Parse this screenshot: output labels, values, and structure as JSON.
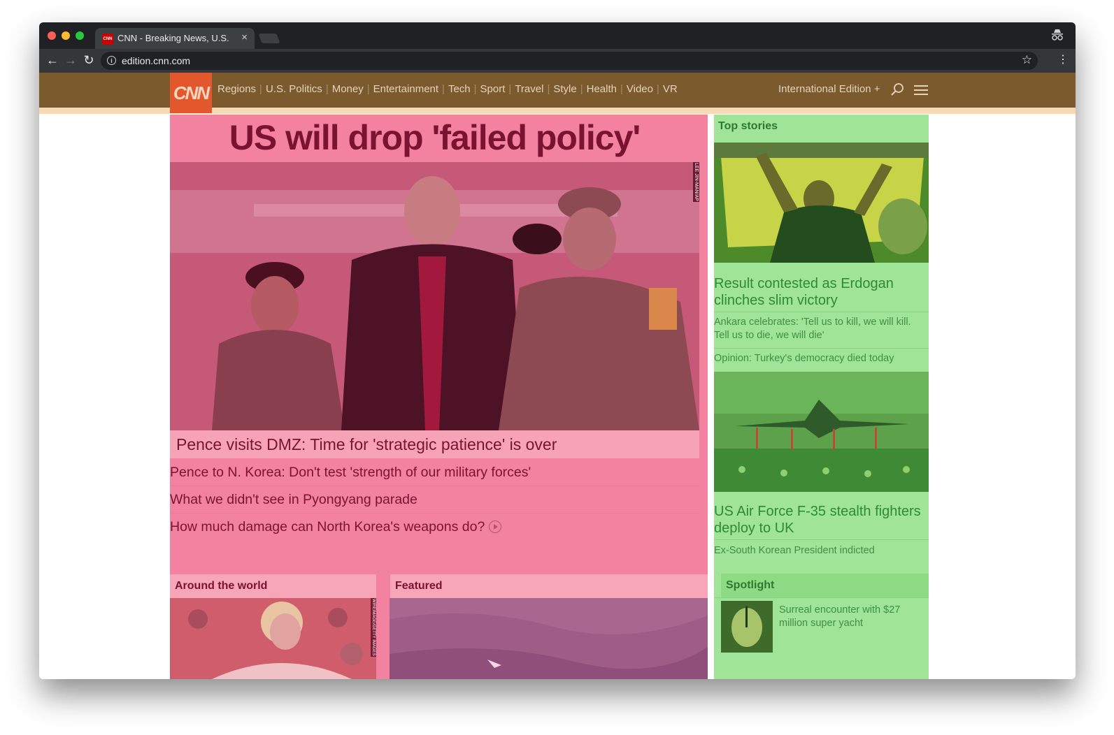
{
  "browser": {
    "tab_title": "CNN - Breaking News, U.S., W",
    "favicon_text": "CNN",
    "url": "edition.cnn.com"
  },
  "nav": {
    "logo": "CNN",
    "links": [
      "Regions",
      "U.S. Politics",
      "Money",
      "Entertainment",
      "Tech",
      "Sport",
      "Travel",
      "Style",
      "Health",
      "Video",
      "VR"
    ],
    "edition": "International Edition +"
  },
  "main": {
    "headline": "US will drop 'failed policy'",
    "hero_credit": "LEE JIN-MAN/AP",
    "hero_caption": "Pence visits DMZ: Time for 'strategic patience' is over",
    "related": [
      "Pence to N. Korea: Don't test 'strength of our military forces'",
      "What we didn't see in Pyongyang parade",
      "How much damage can North Korea's weapons do?"
    ],
    "around_world": "Around the world",
    "around_credit": "WIREIMAGE/GETTY IMAGES",
    "featured": "Featured"
  },
  "side": {
    "heading": "Top stories",
    "story1_title": "Result contested as Erdogan clinches slim victory",
    "story1_items": [
      "Ankara celebrates: 'Tell us to kill, we will kill. Tell us to die, we will die'",
      "Opinion: Turkey's democracy died today"
    ],
    "story2_title": "US Air Force F-35 stealth fighters deploy to UK",
    "story2_items": [
      "Ex-South Korean President indicted"
    ],
    "spotlight": "Spotlight",
    "spotlight_text": "Surreal encounter with $27 million super yacht"
  },
  "colors": {
    "main_overlay": "#f382a0",
    "side_overlay": "#9fe497",
    "nav_bg": "#7b5a2e",
    "logo_bg": "#e2572b"
  }
}
